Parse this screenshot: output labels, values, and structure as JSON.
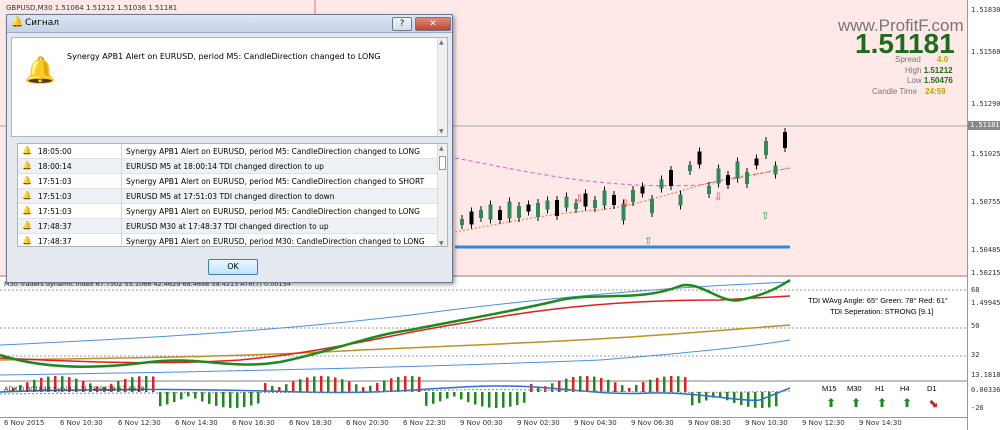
{
  "chart": {
    "title": "GBPUSD,M30  1.51064 1.51212 1.51036 1.51181",
    "watermark": "www.ProfitF.com",
    "big_price": "1.51181",
    "info": [
      {
        "key": "Spread",
        "value": "4.0",
        "color": "#c8a000"
      },
      {
        "key": "High",
        "value": "1.51212",
        "color": "#1e6b1e"
      },
      {
        "key": "Low",
        "value": "1.50476",
        "color": "#1e6b1e"
      },
      {
        "key": "Candle Time",
        "value": "24:59",
        "color": "#c8a000"
      }
    ],
    "current_price_marker": "1.51181",
    "price_ticks": [
      "1.51830",
      "1.51560",
      "1.51290",
      "1.51025",
      "1.50755",
      "1.50485",
      "1.50215",
      "1.49945"
    ],
    "sub1_ticks": [
      "68",
      "50",
      "32",
      "13.1818"
    ],
    "sub2_ticks": [
      "0.003368",
      "-26"
    ],
    "time_ticks": [
      "6 Nov 2015",
      "6 Nov 10:30",
      "6 Nov 12:30",
      "6 Nov 14:30",
      "6 Nov 16:30",
      "6 Nov 18:30",
      "6 Nov 20:30",
      "6 Nov 22:30",
      "9 Nov 00:30",
      "9 Nov 02:30",
      "9 Nov 04:30",
      "9 Nov 06:30",
      "9 Nov 08:30",
      "9 Nov 10:30",
      "9 Nov 12:30",
      "9 Nov 14:30"
    ],
    "sub1_title": "M30 Traders dynamic index 67.7502 55.1066 42.4629 68.4698 59.4213  ATR(7) 0.00154",
    "sub2_title": "ADX 0.001848  Syn(8,3,3) 78.9428 67.8628",
    "tdi_angle": "TDI WAvg Angle: 65°  Green: 78°  Red: 61°",
    "tdi_separation": "TDI Seperation: STRONG [9.1]",
    "timeframes": [
      {
        "label": "M15",
        "arrow": "⬆",
        "color": "#1e8a1e"
      },
      {
        "label": "M30",
        "arrow": "⬆",
        "color": "#1e8a1e"
      },
      {
        "label": "H1",
        "arrow": "⬆",
        "color": "#1e8a1e"
      },
      {
        "label": "H4",
        "arrow": "⬆",
        "color": "#1e8a1e"
      },
      {
        "label": "D1",
        "arrow": "⬊",
        "color": "#d42020"
      }
    ]
  },
  "dialog": {
    "title": "Сигнал",
    "help_label": "?",
    "close_label": "✕",
    "message": "Synergy APB1 Alert on EURUSD, period M5: CandleDirection changed to LONG",
    "ok_label": "OK",
    "log": [
      {
        "time": "18:05:00",
        "text": "Synergy APB1 Alert on EURUSD, period M5: CandleDirection changed to LONG"
      },
      {
        "time": "18:00:14",
        "text": "EURUSD M5 at 18:00:14 TDI changed direction to up"
      },
      {
        "time": "17:51:03",
        "text": "Synergy APB1 Alert on EURUSD, period M5: CandleDirection changed to SHORT"
      },
      {
        "time": "17:51:03",
        "text": "EURUSD M5 at 17:51:03 TDI changed direction to down"
      },
      {
        "time": "17:51:03",
        "text": "Synergy APB1 Alert on EURUSD, period M5: CandleDirection changed to LONG"
      },
      {
        "time": "17:48:37",
        "text": "EURUSD M30 at 17:48:37 TDI changed direction to up"
      },
      {
        "time": "17:48:37",
        "text": "Synergy APB1 Alert on EURUSD, period M30: CandleDirection changed to LONG"
      }
    ]
  }
}
